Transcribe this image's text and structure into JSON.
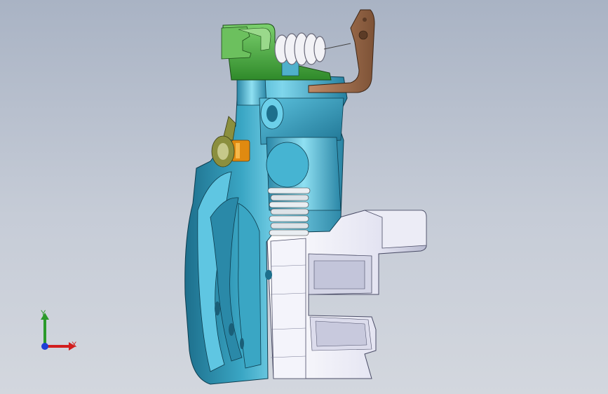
{
  "viewport": {
    "background_top": "#a9b3c4",
    "background_bottom": "#d3d7de"
  },
  "model": {
    "colors": {
      "caliper_body": "#2f94b2",
      "caliper_highlight": "#7fd6ec",
      "bracket": "#e4e4f2",
      "bracket_shade": "#b9bbd1",
      "lever": "#3d9e33",
      "lever_light": "#7cd06e",
      "spring": "#f2f2f6",
      "cable_bracket": "#9b6a4a",
      "nut": "#e08a10",
      "bolt": "#8b8f3e"
    }
  },
  "triad": {
    "x_label": "X",
    "y_label": "Y",
    "x_color": "#d21e1e",
    "y_color": "#2a9a2a",
    "z_color": "#1f3fd6"
  }
}
